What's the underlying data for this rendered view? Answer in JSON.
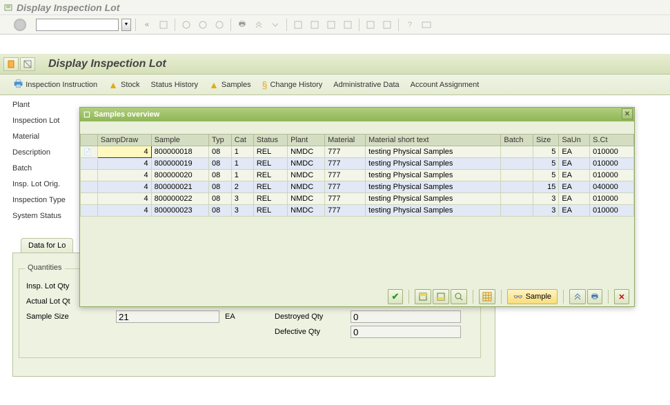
{
  "window": {
    "title": "Display Inspection Lot"
  },
  "header": {
    "title": "Display Inspection Lot"
  },
  "toolbar2": {
    "inspection_instruction": "Inspection Instruction",
    "stock": "Stock",
    "status_history": "Status History",
    "samples": "Samples",
    "change_history": "Change History",
    "admin_data": "Administrative Data",
    "account_assignment": "Account Assignment"
  },
  "form_labels": {
    "plant": "Plant",
    "inspection_lot": "Inspection Lot",
    "material": "Material",
    "description": "Description",
    "batch": "Batch",
    "insp_lot_orig": "Insp. Lot Orig.",
    "inspection_type": "Inspection Type",
    "system_status": "System Status"
  },
  "tab": {
    "data_for_lot": "Data for Lo"
  },
  "quantities": {
    "group_title": "Quantities",
    "insp_lot_qty": "Insp. Lot Qty",
    "actual_lot_qty": "Actual Lot Qt",
    "sample_size": "Sample Size",
    "sample_size_val": "21",
    "sample_size_unit": "EA",
    "destroyed_qty": "Destroyed Qty",
    "destroyed_val": "0",
    "defective_qty": "Defective Qty",
    "defective_val": "0"
  },
  "dialog": {
    "title": "Samples overview",
    "sample_button": "Sample",
    "columns": [
      "SampDraw",
      "Sample",
      "Typ",
      "Cat",
      "Status",
      "Plant",
      "Material",
      "Material short text",
      "Batch",
      "Size",
      "SaUn",
      "S.Ct"
    ],
    "rows": [
      {
        "sampdraw": "4",
        "sample": "800000018",
        "typ": "08",
        "cat": "1",
        "status": "REL",
        "plant": "NMDC",
        "material": "777",
        "shorttext": "testing Physical Samples",
        "batch": "",
        "size": "5",
        "saun": "EA",
        "sct": "010000"
      },
      {
        "sampdraw": "4",
        "sample": "800000019",
        "typ": "08",
        "cat": "1",
        "status": "REL",
        "plant": "NMDC",
        "material": "777",
        "shorttext": "testing Physical Samples",
        "batch": "",
        "size": "5",
        "saun": "EA",
        "sct": "010000"
      },
      {
        "sampdraw": "4",
        "sample": "800000020",
        "typ": "08",
        "cat": "1",
        "status": "REL",
        "plant": "NMDC",
        "material": "777",
        "shorttext": "testing Physical Samples",
        "batch": "",
        "size": "5",
        "saun": "EA",
        "sct": "010000"
      },
      {
        "sampdraw": "4",
        "sample": "800000021",
        "typ": "08",
        "cat": "2",
        "status": "REL",
        "plant": "NMDC",
        "material": "777",
        "shorttext": "testing Physical Samples",
        "batch": "",
        "size": "15",
        "saun": "EA",
        "sct": "040000"
      },
      {
        "sampdraw": "4",
        "sample": "800000022",
        "typ": "08",
        "cat": "3",
        "status": "REL",
        "plant": "NMDC",
        "material": "777",
        "shorttext": "testing Physical Samples",
        "batch": "",
        "size": "3",
        "saun": "EA",
        "sct": "010000"
      },
      {
        "sampdraw": "4",
        "sample": "800000023",
        "typ": "08",
        "cat": "3",
        "status": "REL",
        "plant": "NMDC",
        "material": "777",
        "shorttext": "testing Physical Samples",
        "batch": "",
        "size": "3",
        "saun": "EA",
        "sct": "010000"
      }
    ]
  }
}
